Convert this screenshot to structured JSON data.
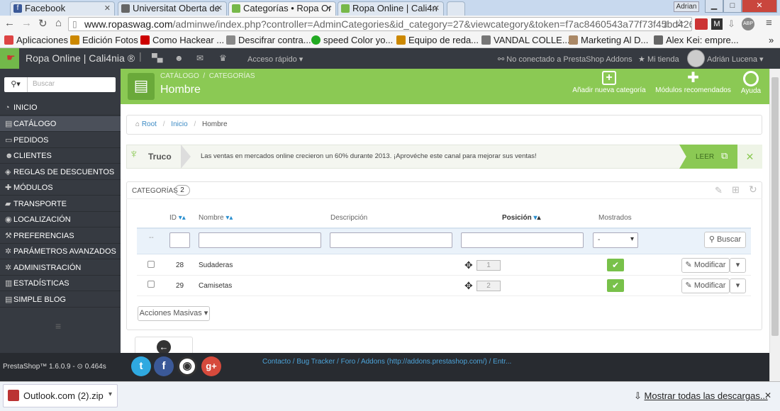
{
  "browser": {
    "tabs": [
      {
        "label": "Facebook",
        "color": "#3b5998",
        "glyph": "f"
      },
      {
        "label": "Universitat Oberta de",
        "color": "#555555",
        "glyph": ""
      },
      {
        "label": "Categorías • Ropa Or",
        "color": "#77b84a",
        "glyph": ""
      },
      {
        "label": "Ropa Online | Cali4n",
        "color": "#77b84a",
        "glyph": ""
      }
    ],
    "user": "Adrian",
    "url_host": "www.ropaswag.com",
    "url_path": "/adminwe/index.php?controller=AdminCategories&id_category=27&viewcategory&token=f7ac8460543a77f73f45bd42655",
    "bookmarks": [
      {
        "label": "Aplicaciones",
        "color": "#d44"
      },
      {
        "label": "Edición Fotos",
        "color": "#c80"
      },
      {
        "label": "Como Hackear ...",
        "color": "#c00"
      },
      {
        "label": "Descifrar contra...",
        "color": "#888"
      },
      {
        "label": "speed Color yo...",
        "color": "#2a2"
      },
      {
        "label": "Equipo de reda...",
        "color": "#c80"
      },
      {
        "label": "VANDAL COLLE...",
        "color": "#777"
      },
      {
        "label": "Marketing Al D...",
        "color": "#a86"
      },
      {
        "label": "Alex Kei: empre...",
        "color": "#666"
      }
    ]
  },
  "admin": {
    "shop_name": "Ropa Online | Cali4nia ®",
    "quick_access": "Acceso rápido",
    "addons_status": "No conectado a PrestaShop Addons",
    "my_shop": "Mi tienda",
    "user_name": "Adrián Lucena",
    "search_placeholder": "Buscar"
  },
  "sidebar": {
    "items": [
      {
        "label": "INICIO",
        "icon": "dashboard-icon",
        "glyph": "◔"
      },
      {
        "label": "CATÁLOGO",
        "icon": "book-icon",
        "glyph": "▤"
      },
      {
        "label": "PEDIDOS",
        "icon": "credit-card-icon",
        "glyph": "▭"
      },
      {
        "label": "CLIENTES",
        "icon": "users-icon",
        "glyph": "☻"
      },
      {
        "label": "REGLAS DE DESCUENTOS",
        "icon": "tags-icon",
        "glyph": "◈"
      },
      {
        "label": "MÓDULOS",
        "icon": "puzzle-icon",
        "glyph": "✚"
      },
      {
        "label": "TRANSPORTE",
        "icon": "truck-icon",
        "glyph": "▰"
      },
      {
        "label": "LOCALIZACIÓN",
        "icon": "globe-icon",
        "glyph": "◉"
      },
      {
        "label": "PREFERENCIAS",
        "icon": "wrench-icon",
        "glyph": "⚒"
      },
      {
        "label": "PARÁMETROS AVANZADOS",
        "icon": "cogs-icon",
        "glyph": "✲"
      },
      {
        "label": "ADMINISTRACIÓN",
        "icon": "gear-icon",
        "glyph": "✲"
      },
      {
        "label": "ESTADÍSTICAS",
        "icon": "bar-chart-icon",
        "glyph": "▥"
      },
      {
        "label": "SIMPLE BLOG",
        "icon": "book-icon",
        "glyph": "▤"
      }
    ]
  },
  "page": {
    "breadcrumb_catalog": "CATÁLOGO",
    "breadcrumb_categories": "CATEGORÍAS",
    "title": "Hombre",
    "actions": {
      "add": "Añadir nueva categoría",
      "modules": "Módulos recomendados",
      "help": "Ayuda"
    }
  },
  "trail": {
    "root": "Root",
    "home": "Inicio",
    "current": "Hombre"
  },
  "tip": {
    "label": "Truco",
    "text": "Las ventas en mercados online crecieron un 60% durante 2013. ¡Aprovéche este canal para mejorar sus ventas!",
    "read": "LEER"
  },
  "table": {
    "title": "CATEGORÍAS",
    "count": "2",
    "headers": {
      "id": "ID",
      "name": "Nombre",
      "desc": "Descripción",
      "pos": "Posición",
      "shown": "Mostrados"
    },
    "filter_reset": "--",
    "select_value": "-",
    "search_btn": "Buscar",
    "rows": [
      {
        "id": "28",
        "name": "Sudaderas",
        "position": "1",
        "edit": "Modificar"
      },
      {
        "id": "29",
        "name": "Camisetas",
        "position": "2",
        "edit": "Modificar"
      }
    ],
    "bulk": "Acciones Masivas"
  },
  "footer": {
    "version": "PrestaShop™ 1.6.0.9 - ",
    "time": "0.464s",
    "links": "Contacto / Bug Tracker / Foro / Addons (http://addons.prestashop.com/) / Entr..."
  },
  "downloads": {
    "file": "Outlook.com (2).zip",
    "show_all": "Mostrar todas las descargas..."
  }
}
